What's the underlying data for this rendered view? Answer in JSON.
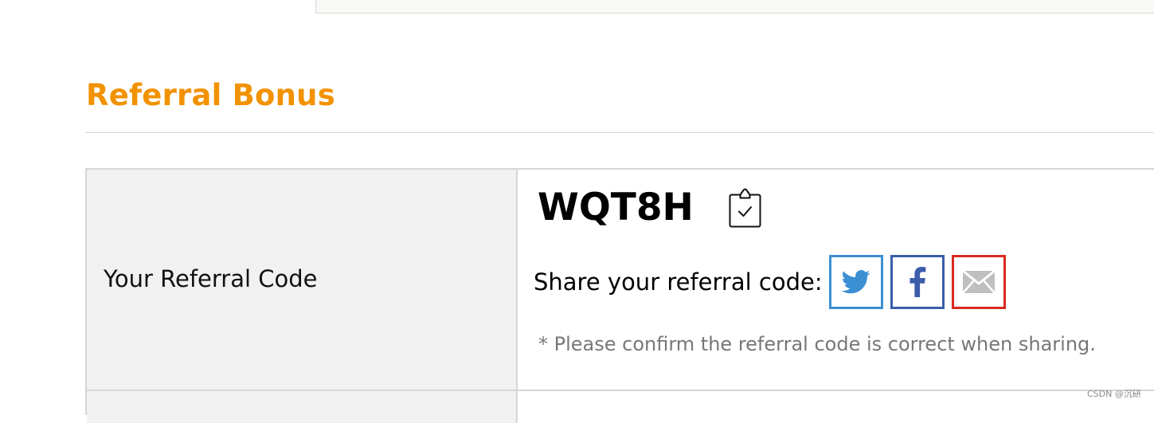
{
  "section": {
    "title": "Referral Bonus"
  },
  "referral": {
    "row_label": "Your Referral Code",
    "code": "WQT8H",
    "copy_icon": "clipboard-check-icon",
    "share_label": "Share your referral code:",
    "share_buttons": [
      {
        "name": "twitter",
        "icon": "twitter-icon",
        "color": "#3b8fd3"
      },
      {
        "name": "facebook",
        "icon": "facebook-icon",
        "color": "#3b5daa"
      },
      {
        "name": "email",
        "icon": "mail-icon",
        "color": "#d92a21"
      }
    ],
    "note": "*  Please confirm the referral code is correct when sharing."
  },
  "watermark": "CSDN @沉研",
  "colors": {
    "title": "#f29200",
    "label_background": "#f1f1f1",
    "note_text": "#777777"
  }
}
